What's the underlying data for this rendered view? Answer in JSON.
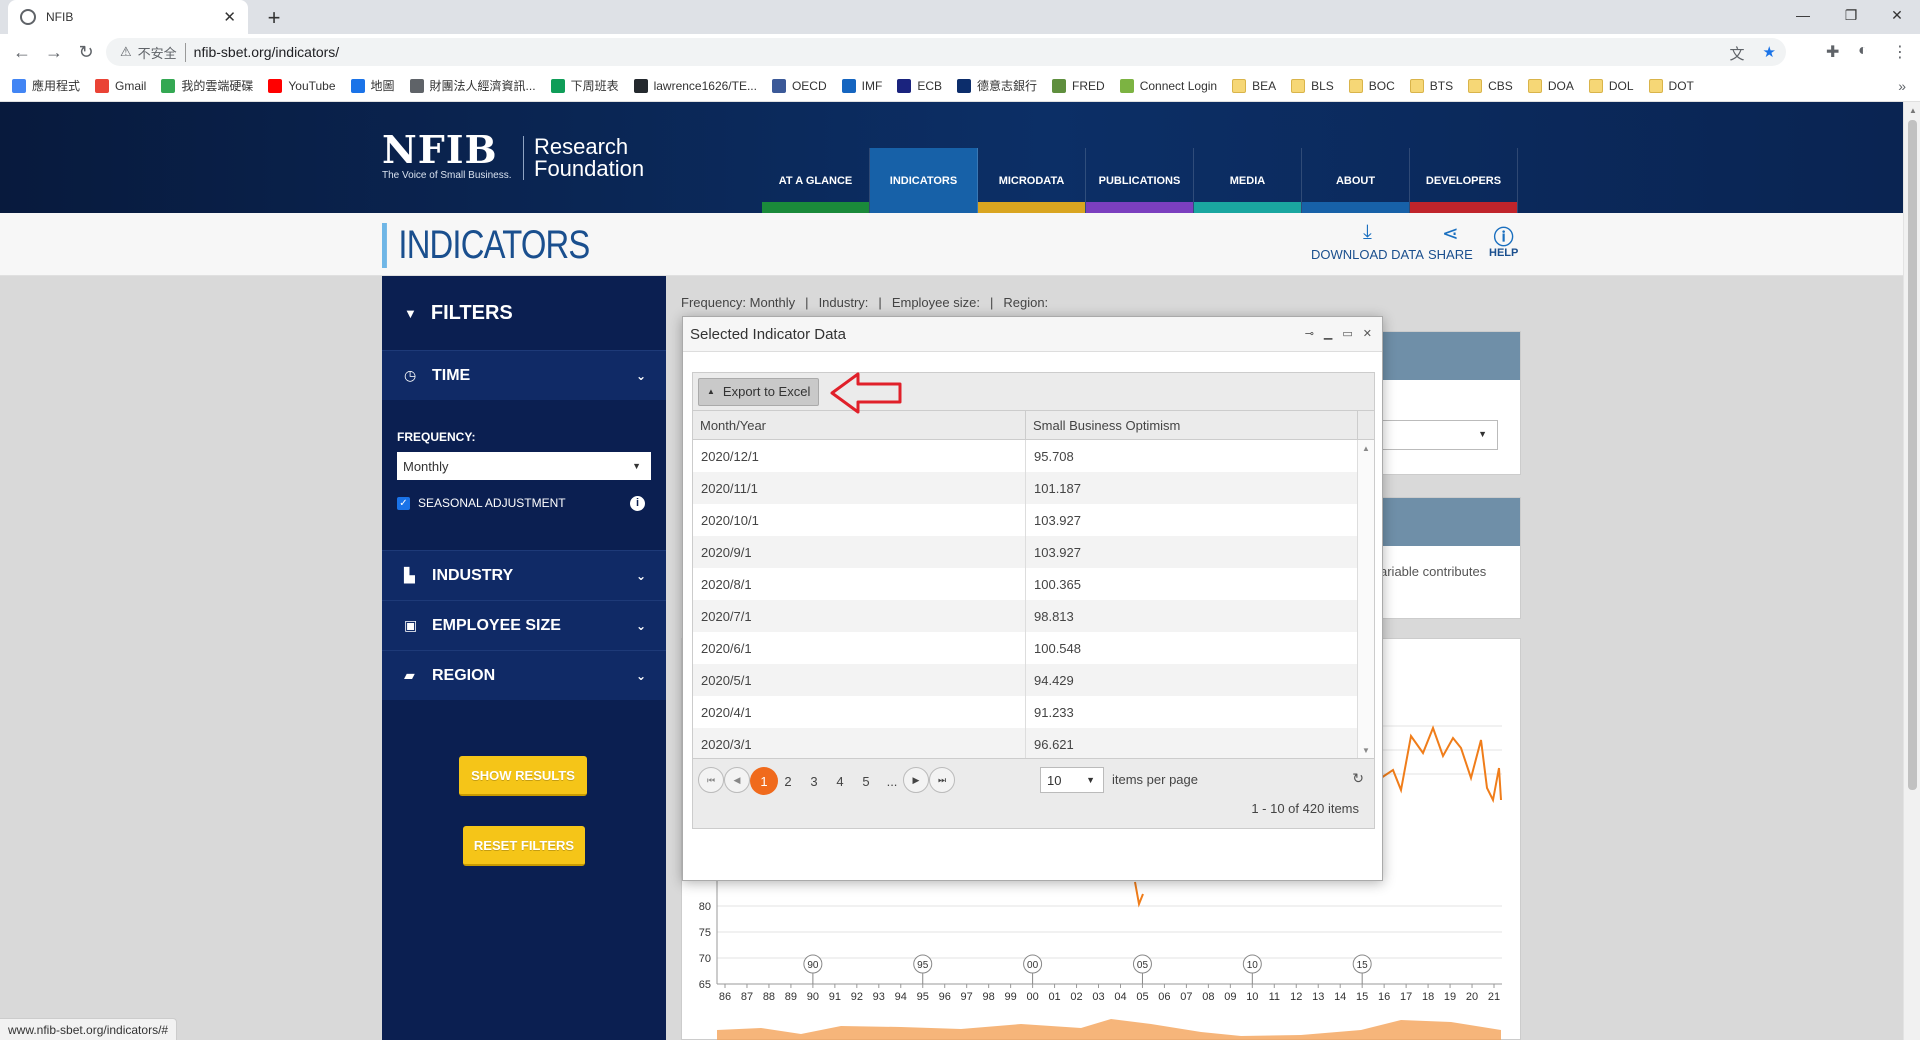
{
  "browser": {
    "tab_title": "NFIB",
    "url_warning": "不安全",
    "url": "nfib-sbet.org/indicators/",
    "bookmarks": [
      "應用程式",
      "Gmail",
      "我的雲端硬碟",
      "YouTube",
      "地圖",
      "財團法人經濟資訊...",
      "下周班表",
      "lawrence1626/TE...",
      "OECD",
      "IMF",
      "ECB",
      "德意志銀行",
      "FRED",
      "Connect Login",
      "BEA",
      "BLS",
      "BOC",
      "BTS",
      "CBS",
      "DOA",
      "DOL",
      "DOT"
    ],
    "status_url": "www.nfib-sbet.org/indicators/#"
  },
  "header": {
    "logo": "NFIB",
    "tagline": "The Voice of Small Business.",
    "research_line1": "Research",
    "research_line2": "Foundation",
    "nav": [
      {
        "label": "AT A GLANCE",
        "color": "#1a8a3a"
      },
      {
        "label": "INDICATORS",
        "color": "#1761a8"
      },
      {
        "label": "MICRODATA",
        "color": "#d9a520"
      },
      {
        "label": "PUBLICATIONS",
        "color": "#7b3fbf"
      },
      {
        "label": "MEDIA",
        "color": "#1aa6a0"
      },
      {
        "label": "ABOUT",
        "color": "#1761a8"
      },
      {
        "label": "DEVELOPERS",
        "color": "#c0242b"
      }
    ]
  },
  "page": {
    "title": "INDICATORS",
    "download": "DOWNLOAD DATA",
    "share": "SHARE",
    "help": "HELP"
  },
  "sidebar": {
    "filters": "FILTERS",
    "time": "TIME",
    "frequency_label": "FREQUENCY:",
    "frequency_value": "Monthly",
    "seasonal": "SEASONAL ADJUSTMENT",
    "industry": "INDUSTRY",
    "employee_size": "EMPLOYEE SIZE",
    "region": "REGION",
    "show_results": "SHOW RESULTS",
    "reset_filters": "RESET FILTERS"
  },
  "crumbs": [
    "Frequency: Monthly",
    "|",
    "Industry:",
    "|",
    "Employee size:",
    "|",
    "Region:"
  ],
  "background": {
    "variable_text": "ariable contributes"
  },
  "modal": {
    "title": "Selected Indicator Data",
    "export": "Export to Excel",
    "columns": [
      "Month/Year",
      "Small Business Optimism"
    ],
    "rows": [
      [
        "2020/12/1",
        "95.708"
      ],
      [
        "2020/11/1",
        "101.187"
      ],
      [
        "2020/10/1",
        "103.927"
      ],
      [
        "2020/9/1",
        "103.927"
      ],
      [
        "2020/8/1",
        "100.365"
      ],
      [
        "2020/7/1",
        "98.813"
      ],
      [
        "2020/6/1",
        "100.548"
      ],
      [
        "2020/5/1",
        "94.429"
      ],
      [
        "2020/4/1",
        "91.233"
      ],
      [
        "2020/3/1",
        "96.621"
      ]
    ],
    "pages": [
      "1",
      "2",
      "3",
      "4",
      "5",
      "..."
    ],
    "per_page": "10",
    "per_page_label": "items per page",
    "info": "1 - 10 of 420 items"
  },
  "chart_data": {
    "type": "line",
    "y_ticks": [
      "80",
      "75",
      "70",
      "65"
    ],
    "x_ticks": [
      "86",
      "87",
      "88",
      "89",
      "90",
      "91",
      "92",
      "93",
      "94",
      "95",
      "96",
      "97",
      "98",
      "99",
      "00",
      "01",
      "02",
      "03",
      "04",
      "05",
      "06",
      "07",
      "08",
      "09",
      "10",
      "11",
      "12",
      "13",
      "14",
      "15",
      "16",
      "17",
      "18",
      "19",
      "20",
      "21"
    ],
    "markers": [
      "90",
      "95",
      "00",
      "05",
      "10",
      "15"
    ],
    "colors": {
      "line": "#f07d1a",
      "area": "#f4a259"
    }
  }
}
